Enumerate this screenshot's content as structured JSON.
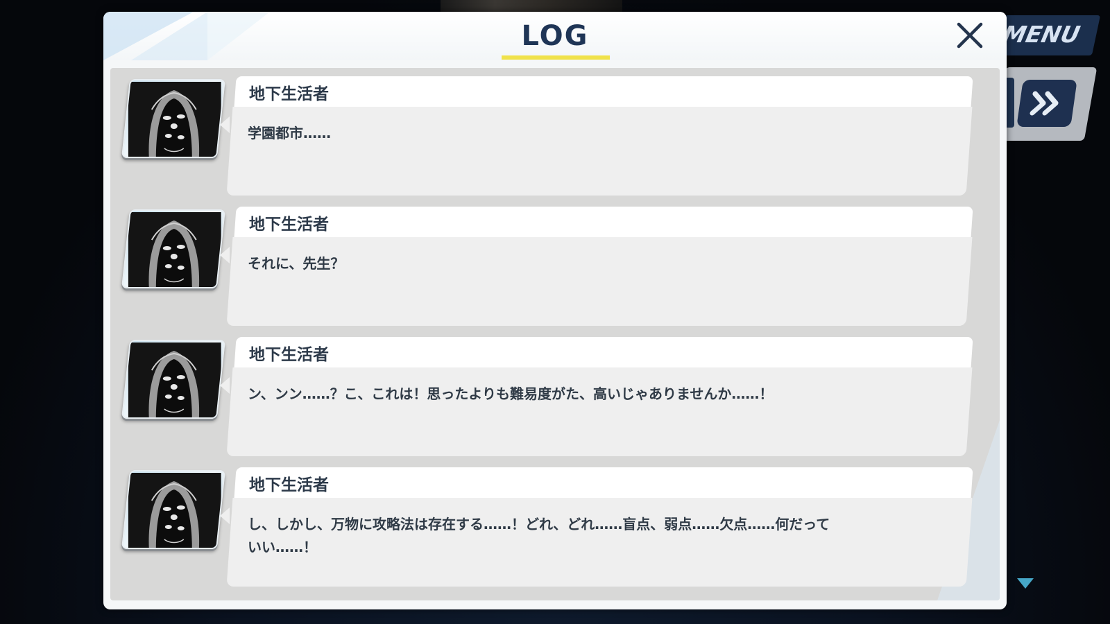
{
  "window": {
    "title": "LOG"
  },
  "menu": {
    "label": "MENU"
  },
  "icons": {
    "close": "close-icon",
    "skip": "fast-forward-icon",
    "scroll_down": "triangle-down-icon",
    "avatar": "character-portrait"
  },
  "colors": {
    "title_text": "#1f3556",
    "title_underline": "#f0e24a",
    "menu_bg": "#1b2f4d",
    "scroll_arrow": "#46a7c8"
  },
  "entries": [
    {
      "speaker": "地下生活者",
      "message": "学園都市……"
    },
    {
      "speaker": "地下生活者",
      "message": "それに、先生？"
    },
    {
      "speaker": "地下生活者",
      "message": "ン、ンン……？こ、これは！思ったよりも難易度がた、高いじゃありませんか……！"
    },
    {
      "speaker": "地下生活者",
      "message": "し、しかし、万物に攻略法は存在する……！どれ、どれ……盲点、弱点……欠点……何だって\nいい……！"
    }
  ]
}
